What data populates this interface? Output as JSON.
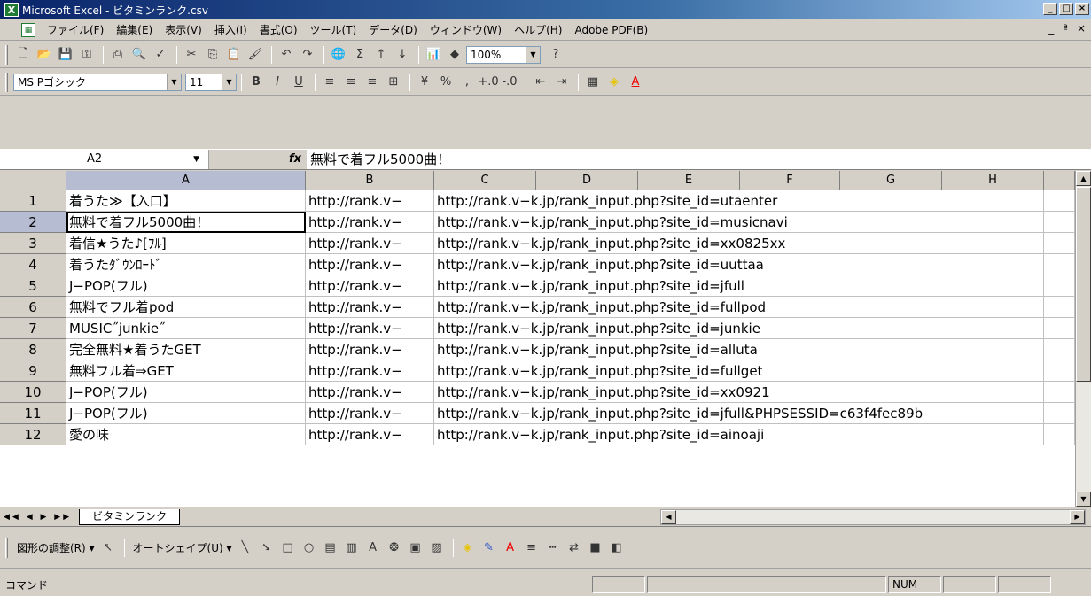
{
  "window": {
    "title": "Microsoft Excel - ビタミンランク.csv",
    "buttons": [
      "_",
      "□",
      "×"
    ]
  },
  "menubar": {
    "items": [
      "ファイル(F)",
      "編集(E)",
      "表示(V)",
      "挿入(I)",
      "書式(O)",
      "ツール(T)",
      "データ(D)",
      "ウィンドウ(W)",
      "ヘルプ(H)",
      "Adobe PDF(B)"
    ],
    "mdi_buttons": [
      "_",
      "ª",
      "×"
    ]
  },
  "standard_toolbar": {
    "zoom": "100%"
  },
  "format_toolbar": {
    "font": "MS Pゴシック",
    "size": "11"
  },
  "formula_bar": {
    "name_box": "A2",
    "fx": "fx",
    "content": "無料で着フル5000曲！"
  },
  "columns": [
    "A",
    "B",
    "C",
    "D",
    "E",
    "F",
    "G",
    "H"
  ],
  "rows": [
    {
      "num": "1",
      "a": "着うた≫【入口】",
      "b": "http://rank.v−",
      "c": "http://rank.v−k.jp/rank_input.php?site_id=utaenter"
    },
    {
      "num": "2",
      "a": "無料で着フル5000曲！",
      "b": "http://rank.v−",
      "c": "http://rank.v−k.jp/rank_input.php?site_id=musicnavi"
    },
    {
      "num": "3",
      "a": "着信★うた♪[ﾌﾙ]",
      "b": "http://rank.v−",
      "c": "http://rank.v−k.jp/rank_input.php?site_id=xx0825xx"
    },
    {
      "num": "4",
      "a": "着うたﾀﾞｳﾝﾛｰﾄﾞ",
      "b": "http://rank.v−",
      "c": "http://rank.v−k.jp/rank_input.php?site_id=uuttaa"
    },
    {
      "num": "5",
      "a": "J−POP(フル)",
      "b": "http://rank.v−",
      "c": "http://rank.v−k.jp/rank_input.php?site_id=jfull"
    },
    {
      "num": "6",
      "a": "無料でフル着pod",
      "b": "http://rank.v−",
      "c": "http://rank.v−k.jp/rank_input.php?site_id=fullpod"
    },
    {
      "num": "7",
      "a": "MUSIC˝junkie˝",
      "b": "http://rank.v−",
      "c": "http://rank.v−k.jp/rank_input.php?site_id=junkie"
    },
    {
      "num": "8",
      "a": "完全無料★着うたGET",
      "b": "http://rank.v−",
      "c": "http://rank.v−k.jp/rank_input.php?site_id=alluta"
    },
    {
      "num": "9",
      "a": "無料フル着⇒GET",
      "b": "http://rank.v−",
      "c": "http://rank.v−k.jp/rank_input.php?site_id=fullget"
    },
    {
      "num": "10",
      "a": "J−POP(フル)",
      "b": "http://rank.v−",
      "c": "http://rank.v−k.jp/rank_input.php?site_id=xx0921"
    },
    {
      "num": "11",
      "a": "J−POP(フル)",
      "b": "http://rank.v−",
      "c": "http://rank.v−k.jp/rank_input.php?site_id=jfull&PHPSESSID=c63f4fec89b"
    },
    {
      "num": "12",
      "a": "愛の味",
      "b": "http://rank.v−",
      "c": "http://rank.v−k.jp/rank_input.php?site_id=ainoaji"
    }
  ],
  "sheet_tab": "ビタミンランク",
  "drawing_toolbar": {
    "draw_label": "図形の調整(R) ▾",
    "autoshape_label": "オートシェイプ(U) ▾"
  },
  "status": {
    "text": "コマンド",
    "num": "NUM"
  }
}
